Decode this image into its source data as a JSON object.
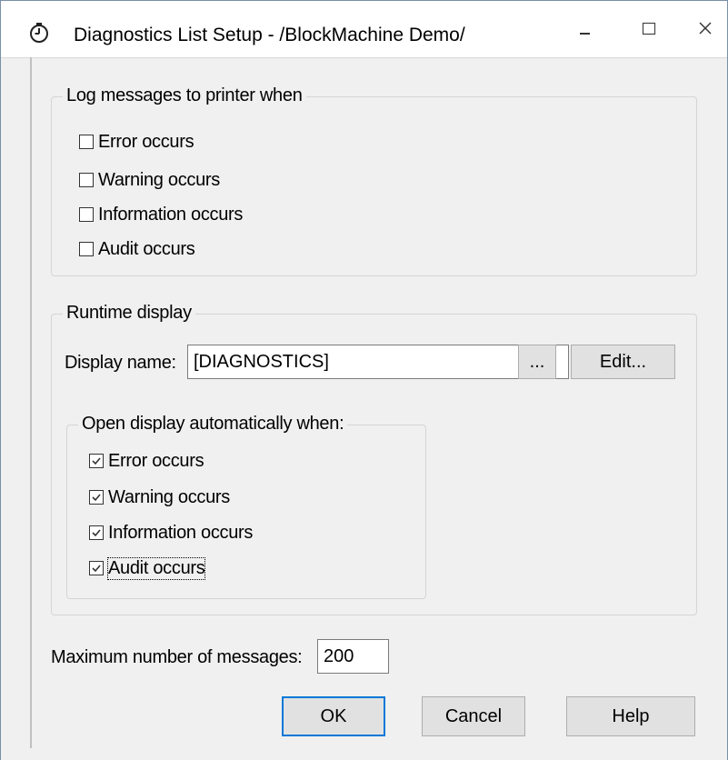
{
  "window": {
    "title": "Diagnostics List Setup - /BlockMachine Demo/",
    "icon": "stopwatch-icon",
    "controls": {
      "minimize": "minimize-icon",
      "maximize": "maximize-icon",
      "close": "close-icon"
    }
  },
  "log_group": {
    "legend": "Log messages to printer when",
    "items": [
      {
        "label": "Error occurs",
        "checked": false
      },
      {
        "label": "Warning occurs",
        "checked": false
      },
      {
        "label": "Information occurs",
        "checked": false
      },
      {
        "label": "Audit occurs",
        "checked": false
      }
    ]
  },
  "runtime_group": {
    "legend": "Runtime display",
    "display_name_label": "Display name:",
    "display_name_value": "[DIAGNOSTICS]",
    "browse_label": "...",
    "edit_label": "Edit...",
    "open_group": {
      "legend": "Open display automatically when:",
      "items": [
        {
          "label": "Error occurs",
          "checked": true
        },
        {
          "label": "Warning occurs",
          "checked": true
        },
        {
          "label": "Information occurs",
          "checked": true
        },
        {
          "label": "Audit occurs",
          "checked": true,
          "focused": true
        }
      ]
    }
  },
  "max_messages": {
    "label": "Maximum number of messages:",
    "value": "200"
  },
  "buttons": {
    "ok": "OK",
    "cancel": "Cancel",
    "help": "Help"
  },
  "colors": {
    "default_button_border": "#0078d7",
    "dialog_background": "#f0f0f0"
  }
}
